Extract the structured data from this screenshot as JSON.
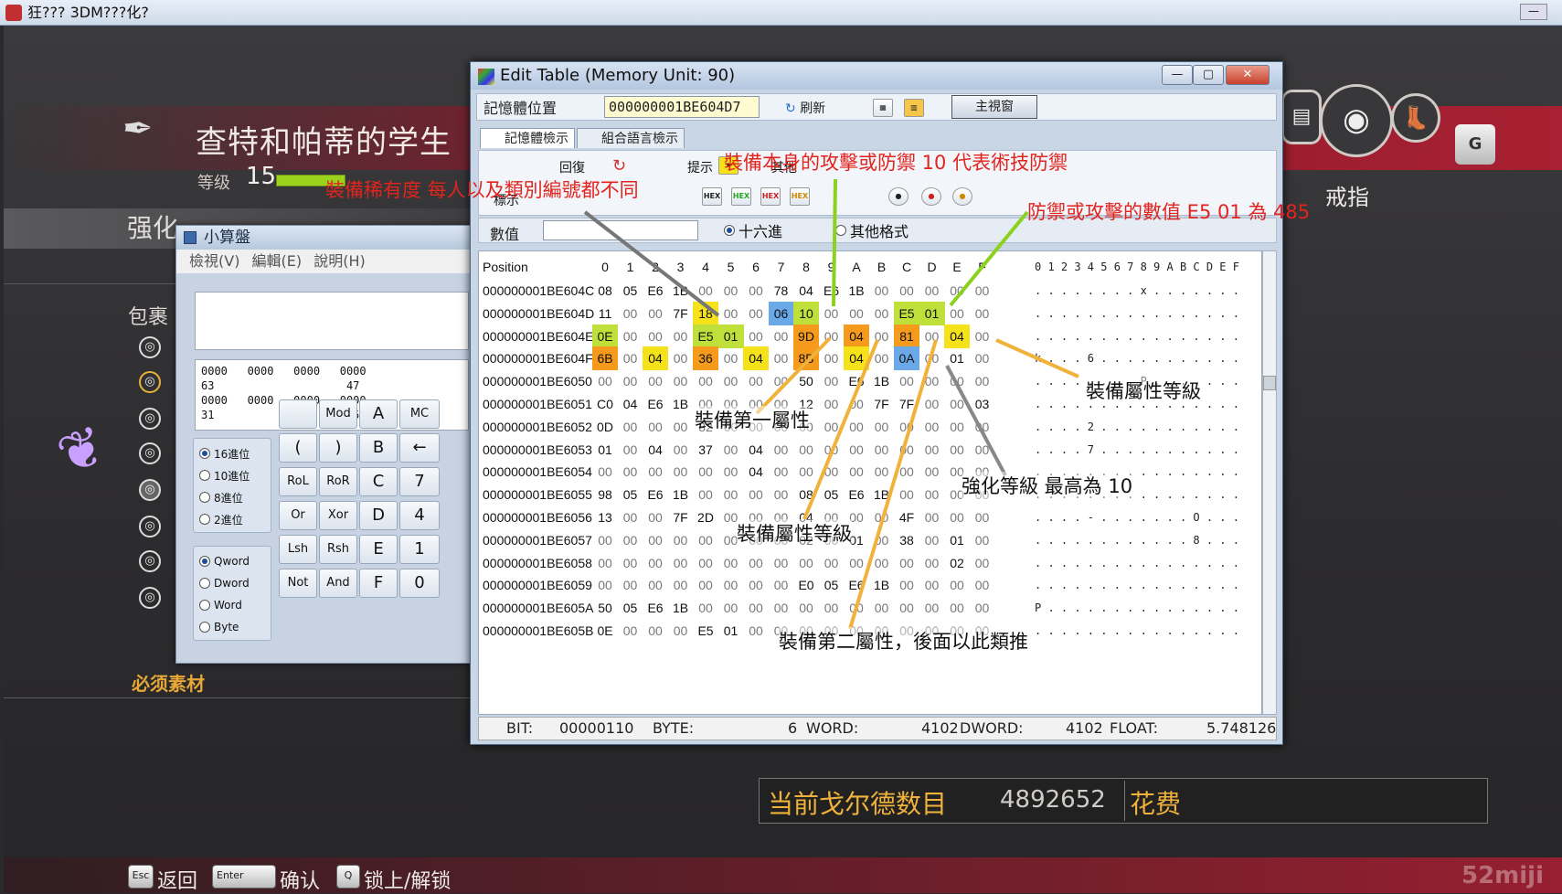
{
  "window": {
    "title": "狂??? 3DM???化?"
  },
  "game": {
    "title": "查特和帕蒂的学生",
    "level_label": "等级",
    "level_value": "15",
    "section": "强化",
    "inventory_label": "包裹",
    "materials_label": "必须素材",
    "ring_label": "戒指",
    "g_button": "G",
    "gold_label": "当前戈尔德数目",
    "gold_value": "4892652",
    "cost_label": "花费",
    "keys": [
      {
        "key": "Esc",
        "label": "返回"
      },
      {
        "key": "Enter",
        "label": "确认"
      },
      {
        "key": "Q",
        "label": "锁上/解锁"
      }
    ],
    "watermark": "52miji"
  },
  "calculator": {
    "title": "小算盤",
    "menu": [
      "檢視(V)",
      "編輯(E)",
      "說明(H)"
    ],
    "bits_lines": [
      "0000   0000   0000   0000",
      "63                    47",
      "0000   0000   0000   0000",
      "31                    15"
    ],
    "base_options": [
      {
        "label": "16進位",
        "checked": true
      },
      {
        "label": "10進位",
        "checked": false
      },
      {
        "label": "8進位",
        "checked": false
      },
      {
        "label": "2進位",
        "checked": false
      }
    ],
    "size_options": [
      {
        "label": "Qword",
        "checked": true
      },
      {
        "label": "Dword",
        "checked": false
      },
      {
        "label": "Word",
        "checked": false
      },
      {
        "label": "Byte",
        "checked": false
      }
    ],
    "buttons": [
      [
        "",
        "Mod",
        "A",
        "MC"
      ],
      [
        "(",
        ")",
        "B",
        "←"
      ],
      [
        "RoL",
        "RoR",
        "C",
        "7"
      ],
      [
        "Or",
        "Xor",
        "D",
        "4"
      ],
      [
        "Lsh",
        "Rsh",
        "E",
        "1"
      ],
      [
        "Not",
        "And",
        "F",
        "0"
      ]
    ]
  },
  "editor": {
    "title": "Edit Table (Memory Unit: 90)",
    "address_label": "記憶體位置",
    "address_value": "000000001BE604D7",
    "refresh_label": "刷新",
    "main_window_label": "主視窗",
    "tabs": [
      "記憶體檢示",
      "組合語言檢示"
    ],
    "toolbar": {
      "undo": "回復",
      "hint": "提示",
      "other": "其他",
      "mark": "標示"
    },
    "value_label": "數值",
    "hex_radio": "十六進",
    "other_radio": "其他格式",
    "column_header": "Position",
    "columns": [
      "0",
      "1",
      "2",
      "3",
      "4",
      "5",
      "6",
      "7",
      "8",
      "9",
      "A",
      "B",
      "C",
      "D",
      "E",
      "F"
    ],
    "ascii_header": "0 1 2 3 4 5 6 7 8 9 A B C D E F",
    "rows": [
      {
        "addr": "000000001BE604C",
        "bytes": [
          "08",
          "05",
          "E6",
          "1B",
          "00",
          "00",
          "00",
          "78",
          "04",
          "E6",
          "1B",
          "00",
          "00",
          "00",
          "00",
          "00"
        ],
        "ascii": ". . . . . . . . x . . . . . . ."
      },
      {
        "addr": "000000001BE604D",
        "bytes": [
          "11",
          "00",
          "00",
          "7F",
          "18",
          "00",
          "00",
          "06",
          "10",
          "00",
          "00",
          "00",
          "E5",
          "01",
          "00",
          "00"
        ],
        "ascii": ". . . . . . . . . . . . . . . ."
      },
      {
        "addr": "000000001BE604E",
        "bytes": [
          "0E",
          "00",
          "00",
          "00",
          "E5",
          "01",
          "00",
          "00",
          "9D",
          "00",
          "04",
          "00",
          "81",
          "00",
          "04",
          "00"
        ],
        "ascii": ". . . . . . . . . . . . . . . ."
      },
      {
        "addr": "000000001BE604F",
        "bytes": [
          "6B",
          "00",
          "04",
          "00",
          "36",
          "00",
          "04",
          "00",
          "8B",
          "00",
          "04",
          "00",
          "0A",
          "00",
          "01",
          "00"
        ],
        "ascii": "k . . . 6 . . . . . . . . . . ."
      },
      {
        "addr": "000000001BE6050",
        "bytes": [
          "00",
          "00",
          "00",
          "00",
          "00",
          "00",
          "00",
          "00",
          "50",
          "00",
          "E6",
          "1B",
          "00",
          "00",
          "00",
          "00"
        ],
        "ascii": ". . . . . . . . P . . . . . . ."
      },
      {
        "addr": "000000001BE6051",
        "bytes": [
          "C0",
          "04",
          "E6",
          "1B",
          "00",
          "00",
          "00",
          "00",
          "12",
          "00",
          "00",
          "7F",
          "7F",
          "00",
          "00",
          "03"
        ],
        "ascii": ". . . . . . . . . . . . . . . ."
      },
      {
        "addr": "000000001BE6052",
        "bytes": [
          "0D",
          "00",
          "00",
          "00",
          "32",
          "00",
          "00",
          "00",
          "00",
          "00",
          "00",
          "00",
          "00",
          "00",
          "00",
          "00"
        ],
        "ascii": ". . . . 2 . . . . . . . . . . ."
      },
      {
        "addr": "000000001BE6053",
        "bytes": [
          "01",
          "00",
          "04",
          "00",
          "37",
          "00",
          "04",
          "00",
          "00",
          "00",
          "00",
          "00",
          "00",
          "00",
          "00",
          "00"
        ],
        "ascii": ". . . . 7 . . . . . . . . . . ."
      },
      {
        "addr": "000000001BE6054",
        "bytes": [
          "00",
          "00",
          "00",
          "00",
          "00",
          "00",
          "04",
          "00",
          "00",
          "00",
          "00",
          "00",
          "00",
          "00",
          "00",
          "00"
        ],
        "ascii": ". . . . . . . . . . . . . . . ."
      },
      {
        "addr": "000000001BE6055",
        "bytes": [
          "98",
          "05",
          "E6",
          "1B",
          "00",
          "00",
          "00",
          "00",
          "08",
          "05",
          "E6",
          "1B",
          "00",
          "00",
          "00",
          "00"
        ],
        "ascii": ". . . . . . . . . . . . . . . ."
      },
      {
        "addr": "000000001BE6056",
        "bytes": [
          "13",
          "00",
          "00",
          "7F",
          "2D",
          "00",
          "00",
          "00",
          "04",
          "00",
          "00",
          "00",
          "4F",
          "00",
          "00",
          "00"
        ],
        "ascii": ". . . . - . . . . . . . O . . ."
      },
      {
        "addr": "000000001BE6057",
        "bytes": [
          "00",
          "00",
          "00",
          "00",
          "00",
          "00",
          "00",
          "00",
          "02",
          "00",
          "01",
          "00",
          "38",
          "00",
          "01",
          "00"
        ],
        "ascii": ". . . . . . . . . . . . 8 . . ."
      },
      {
        "addr": "000000001BE6058",
        "bytes": [
          "00",
          "00",
          "00",
          "00",
          "00",
          "00",
          "00",
          "00",
          "00",
          "00",
          "00",
          "00",
          "00",
          "00",
          "02",
          "00"
        ],
        "ascii": ". . . . . . . . . . . . . . . ."
      },
      {
        "addr": "000000001BE6059",
        "bytes": [
          "00",
          "00",
          "00",
          "00",
          "00",
          "00",
          "00",
          "00",
          "E0",
          "05",
          "E6",
          "1B",
          "00",
          "00",
          "00",
          "00"
        ],
        "ascii": ". . . . . . . . . . . . . . . ."
      },
      {
        "addr": "000000001BE605A",
        "bytes": [
          "50",
          "05",
          "E6",
          "1B",
          "00",
          "00",
          "00",
          "00",
          "00",
          "00",
          "00",
          "00",
          "00",
          "00",
          "00",
          "00"
        ],
        "ascii": "P . . . . . . . . . . . . . . ."
      },
      {
        "addr": "000000001BE605B",
        "bytes": [
          "0E",
          "00",
          "00",
          "00",
          "E5",
          "01",
          "00",
          "00",
          "00",
          "00",
          "00",
          "00",
          "00",
          "00",
          "00",
          "00"
        ],
        "ascii": ". . . . . . . . . . . . . . . ."
      }
    ],
    "status": {
      "bit_label": "BIT:",
      "bit_value": "00000110",
      "byte_label": "BYTE:",
      "byte_value": "6",
      "word_label": "WORD:",
      "word_value": "4102",
      "dword_label": "DWORD:",
      "dword_value": "4102",
      "float_label": "FLOAT:",
      "float_value": "5.748126"
    }
  },
  "annotations": {
    "type_id": "裝備稀有度  每人以及類別編號都不同",
    "attack_defense": "裝備本身的攻擊或防禦 10 代表術技防禦",
    "value_note": "防禦或攻擊的數值  E5 01 為 485",
    "attr_level_right": "裝備屬性等級",
    "first_attr": "裝備第一屬性",
    "enh_level": "強化等級  最高為 10",
    "attr_level_mid": "裝備屬性等級",
    "second_attr": "裝備第二屬性，後面以此類推"
  },
  "colors": {
    "highlight_yellow": "#f5e21a",
    "highlight_orange": "#f59a1a",
    "highlight_green": "#bfe03a",
    "annotation_red": "#e1241e",
    "gold_text": "#f0b23a"
  }
}
